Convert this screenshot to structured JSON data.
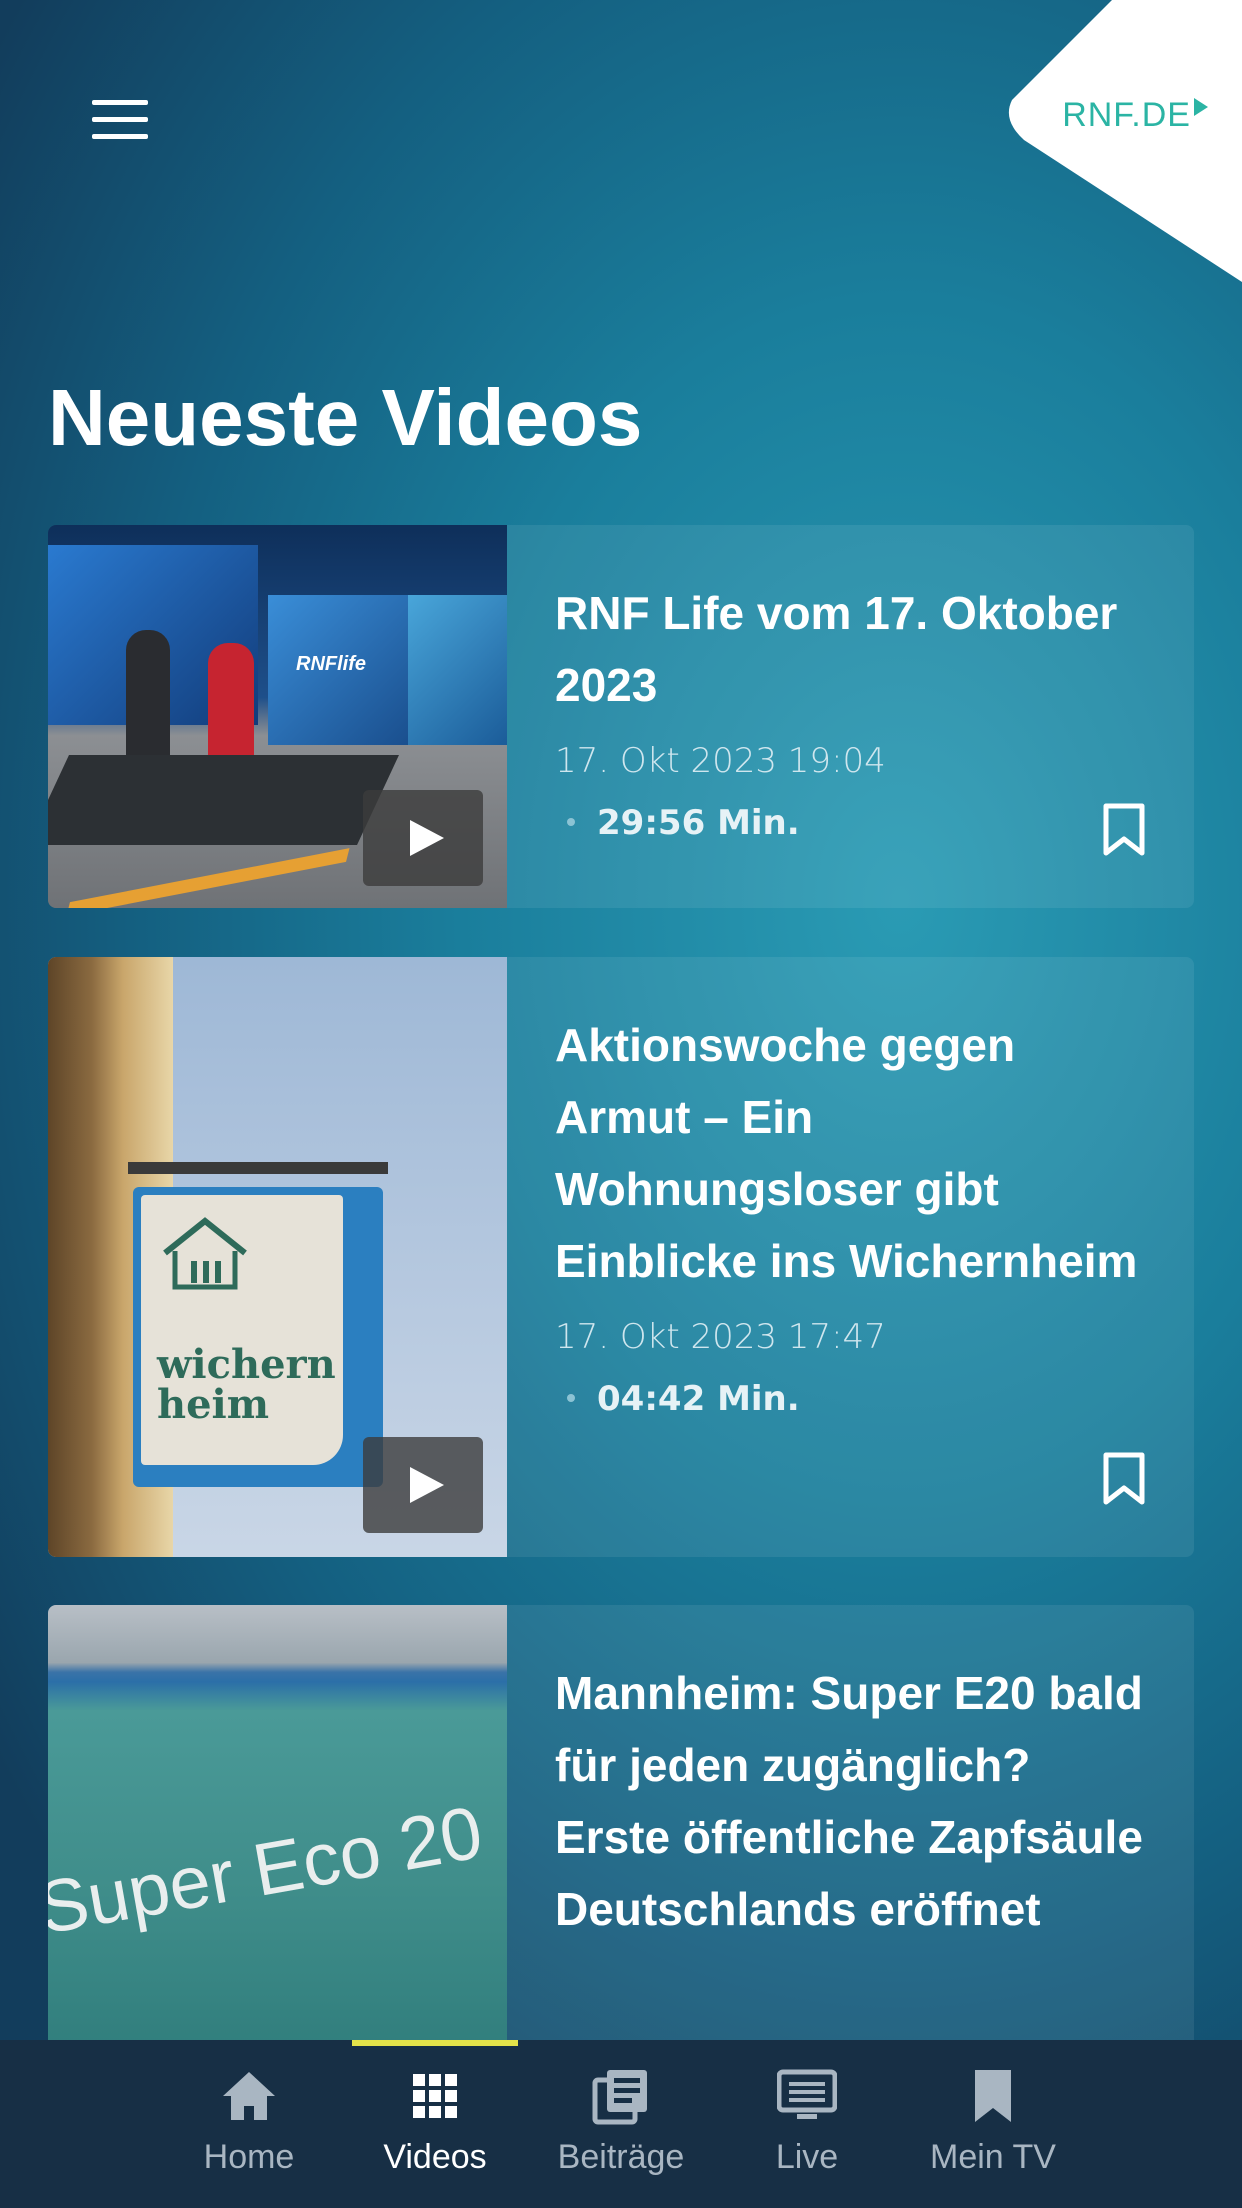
{
  "header": {
    "logo_text": "RNF.DE"
  },
  "section": {
    "title": "Neueste Videos"
  },
  "videos": [
    {
      "title": "RNF Life vom 17. Oktober 2023",
      "date": "17. Okt 2023 19:04",
      "duration": "29:56 Min.",
      "thumb_label": "RNFlife"
    },
    {
      "title": "Aktionswoche gegen Armut – Ein Wohnungsloser gibt Einblicke ins Wichernheim",
      "date": "17. Okt 2023 17:47",
      "duration": "04:42 Min.",
      "thumb_label": "wichern heim"
    },
    {
      "title": "Mannheim: Super E20 bald für jeden zugänglich? Erste öffentliche Zapfsäule Deutschlands eröffnet",
      "thumb_label": "Super Eco 20"
    }
  ],
  "nav": {
    "items": [
      {
        "label": "Home",
        "icon": "home-icon"
      },
      {
        "label": "Videos",
        "icon": "grid-icon"
      },
      {
        "label": "Beiträge",
        "icon": "articles-icon"
      },
      {
        "label": "Live",
        "icon": "live-tv-icon"
      },
      {
        "label": "Mein TV",
        "icon": "bookmark-icon"
      }
    ],
    "active": "Videos",
    "indicator_color": "#e4e34a"
  }
}
